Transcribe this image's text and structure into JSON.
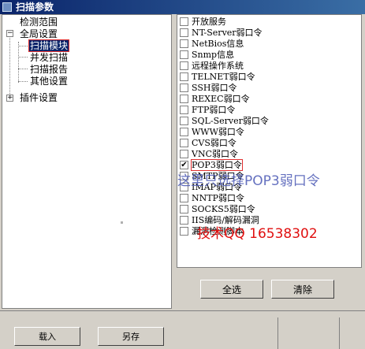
{
  "window": {
    "title": "扫描参数"
  },
  "tree": {
    "scan_range": "检测范围",
    "global_settings": "全局设置",
    "scan_module": "扫描模块",
    "concurrent_scan": "并发扫描",
    "scan_report": "扫描报告",
    "other_settings": "其他设置",
    "plugin_settings": "插件设置"
  },
  "modules": [
    {
      "label": "开放服务",
      "checked": false
    },
    {
      "label": "NT-Server弱口令",
      "checked": false
    },
    {
      "label": "NetBios信息",
      "checked": false
    },
    {
      "label": "Snmp信息",
      "checked": false
    },
    {
      "label": "远程操作系统",
      "checked": false
    },
    {
      "label": "TELNET弱口令",
      "checked": false
    },
    {
      "label": "SSH弱口令",
      "checked": false
    },
    {
      "label": "REXEC弱口令",
      "checked": false
    },
    {
      "label": "FTP弱口令",
      "checked": false
    },
    {
      "label": "SQL-Server弱口令",
      "checked": false
    },
    {
      "label": "WWW弱口令",
      "checked": false
    },
    {
      "label": "CVS弱口令",
      "checked": false
    },
    {
      "label": "VNC弱口令",
      "checked": false
    },
    {
      "label": "POP3弱口令",
      "checked": true
    },
    {
      "label": "SMTP弱口令",
      "checked": false
    },
    {
      "label": "IMAP弱口令",
      "checked": false
    },
    {
      "label": "NNTP弱口令",
      "checked": false
    },
    {
      "label": "SOCKS5弱口令",
      "checked": false
    },
    {
      "label": "IIS编码/解码漏洞",
      "checked": false
    },
    {
      "label": "漏洞检测脚本",
      "checked": false
    }
  ],
  "annotations": {
    "instruction": "这里只选择POP3弱口令",
    "contact": "技术QQ 16538302"
  },
  "buttons": {
    "select_all": "全选",
    "clear": "清除",
    "load": "载入",
    "save_as": "另存"
  },
  "colors": {
    "accent": "#0a246a",
    "highlight": "#e03030",
    "annotation_blue": "#4a58b4",
    "annotation_red": "#e01010"
  }
}
